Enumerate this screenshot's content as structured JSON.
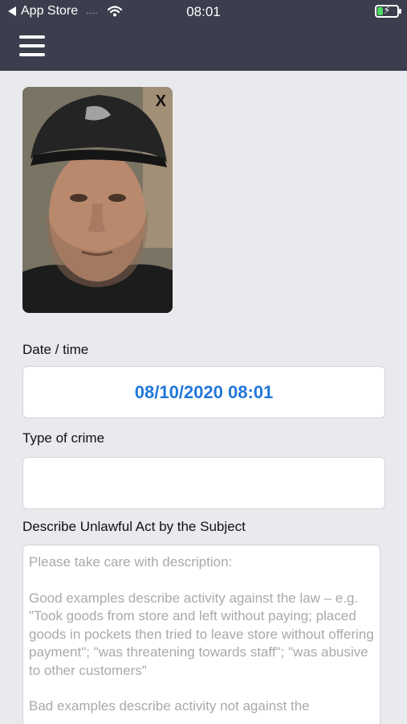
{
  "status_bar": {
    "back_app": "App Store",
    "signal": "....",
    "time": "08:01",
    "battery_level": 0.3,
    "battery_charging_icon": "bolt-icon"
  },
  "header": {
    "menu_icon": "hamburger-menu-icon"
  },
  "photo": {
    "close_label": "X"
  },
  "form": {
    "date_time": {
      "label": "Date / time",
      "value": "08/10/2020 08:01"
    },
    "crime_type": {
      "label": "Type of crime",
      "value": ""
    },
    "description": {
      "label": "Describe Unlawful Act by the Subject",
      "placeholder_intro": "Please take care with description:",
      "placeholder_good": "Good examples describe activity against the law – e.g. \"Took goods from store and left without paying; placed goods in pockets then tried to leave store without offering payment\"; \"was threatening towards staff\"; \"was abusive to other customers\"",
      "placeholder_bad": "Bad examples describe activity not against the"
    }
  },
  "colors": {
    "header_bg": "#3b3f4d",
    "page_bg": "#e9eaee",
    "accent_blue": "#2277d8",
    "placeholder_gray": "#a9a9ae"
  }
}
